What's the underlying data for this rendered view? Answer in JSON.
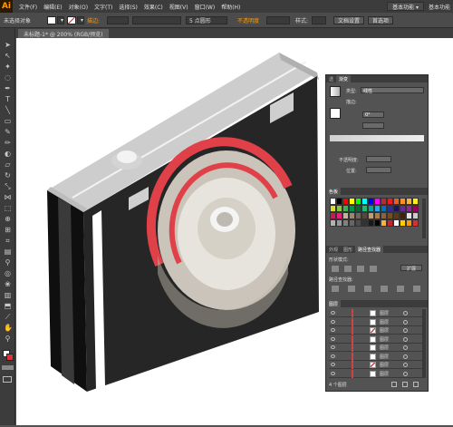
{
  "app": {
    "logo": "Ai",
    "workspace_button": "基本功能 ▾",
    "workspace_label": "基本功能"
  },
  "menu": [
    "文件(F)",
    "编辑(E)",
    "对象(O)",
    "文字(T)",
    "选择(S)",
    "效果(C)",
    "视图(V)",
    "窗口(W)",
    "帮助(H)"
  ],
  "control": {
    "selection_label": "未选择对象",
    "stroke_label": "描边:",
    "stroke_value": "5 点圆形",
    "opacity_label": "不透明度",
    "style_label": "样式:",
    "doc_setup": "文档设置",
    "preferences": "首选项",
    "colors": {
      "fill": "#ffffff",
      "stroke": "#d9343a"
    }
  },
  "document": {
    "tab_title": "未标题-1* @ 200% (RGB/预览)"
  },
  "tools": [
    "selection-icon",
    "direct-selection-icon",
    "magic-wand-icon",
    "lasso-icon",
    "pen-icon",
    "type-icon",
    "line-icon",
    "rectangle-icon",
    "paintbrush-icon",
    "pencil-icon",
    "blob-brush-icon",
    "eraser-icon",
    "rotate-icon",
    "scale-icon",
    "width-icon",
    "free-transform-icon",
    "shape-builder-icon",
    "perspective-icon",
    "mesh-icon",
    "gradient-icon",
    "eyedropper-icon",
    "blend-icon",
    "symbol-sprayer-icon",
    "column-graph-icon",
    "artboard-icon",
    "slice-icon",
    "hand-icon",
    "zoom-icon"
  ],
  "panels": {
    "transparency_tabs": [
      "透",
      "渐变"
    ],
    "gradient": {
      "type_label": "类型:",
      "type_value": "线性",
      "stroke_label": "描边:",
      "angle_value": "0°",
      "opacity_label": "不透明度:",
      "location_label": "位置:"
    },
    "swatches_title": "色板",
    "pathfinder_tabs": [
      "外观",
      "图形",
      "路径查找器"
    ],
    "shape_modes_label": "形状模式:",
    "expand_button": "扩展",
    "pathfinders_label": "路径查找器:",
    "layers_title": "图层",
    "layers_footer": "4 个图层"
  },
  "swatch_colors": [
    "#ffffff",
    "#000000",
    "#ff0000",
    "#ffff00",
    "#00ff00",
    "#00ffff",
    "#0000ff",
    "#ff00ff",
    "#c1272d",
    "#ed1c24",
    "#f15a24",
    "#f7931e",
    "#fbb03b",
    "#fcee21",
    "#d9e021",
    "#8cc63f",
    "#39b54a",
    "#009245",
    "#006837",
    "#22b573",
    "#00a99d",
    "#29abe2",
    "#0071bc",
    "#2e3192",
    "#1b1464",
    "#662d91",
    "#93278f",
    "#9e005d",
    "#d4145a",
    "#ed1e79",
    "#c7b299",
    "#998675",
    "#736357",
    "#534741",
    "#c69c6d",
    "#a67c52",
    "#8c6239",
    "#754c24",
    "#603813",
    "#42210b",
    "#e6e6e6",
    "#cccccc",
    "#b3b3b3",
    "#999999",
    "#808080",
    "#666666",
    "#4d4d4d",
    "#333333",
    "#1a1a1a",
    "#000000",
    "#fbb03b",
    "#c1272d",
    "#ffffff",
    "#ffcc00",
    "#ff9900",
    "#cc3333"
  ],
  "layers": [
    {
      "name": "图层",
      "thumb": "plain"
    },
    {
      "name": "图层",
      "thumb": "plain"
    },
    {
      "name": "图层",
      "thumb": "red"
    },
    {
      "name": "图层",
      "thumb": "plain"
    },
    {
      "name": "图层",
      "thumb": "plain"
    },
    {
      "name": "图层",
      "thumb": "plain"
    },
    {
      "name": "图层",
      "thumb": "red"
    },
    {
      "name": "图层",
      "thumb": "plain"
    }
  ]
}
